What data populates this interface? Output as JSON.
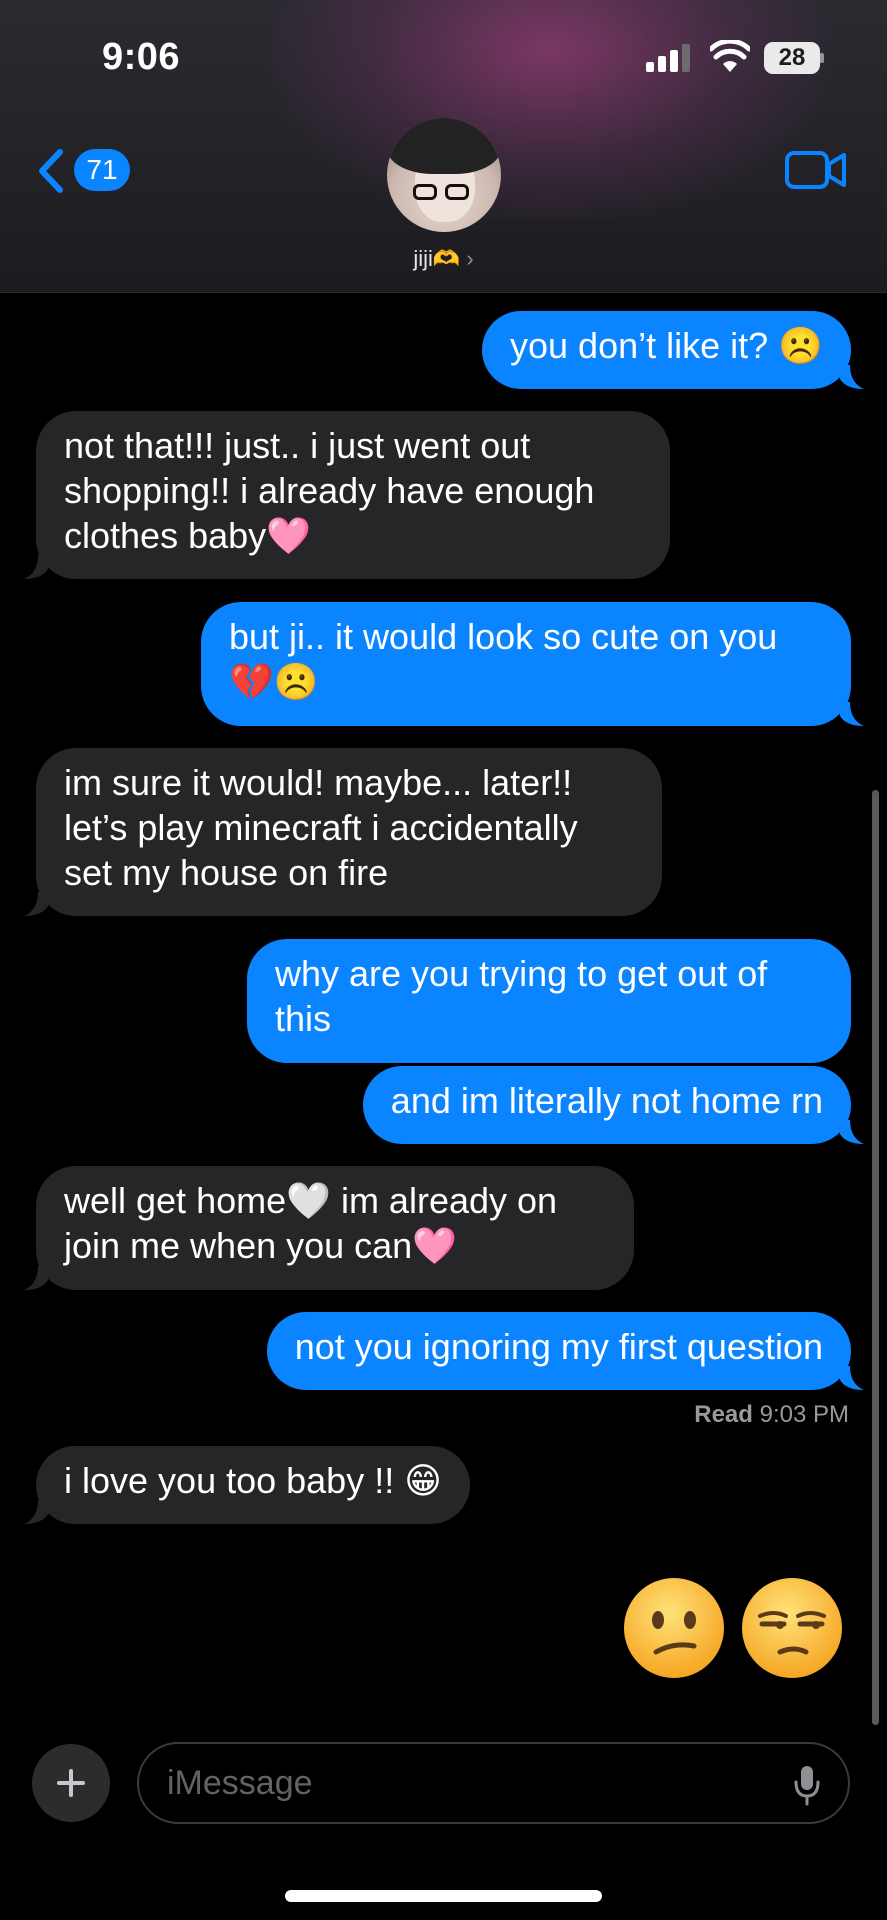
{
  "status_bar": {
    "time": "9:06",
    "battery": "28"
  },
  "nav": {
    "back_badge": "71",
    "contact_name": "jiji🫶",
    "contact_chevron": "›"
  },
  "messages": [
    {
      "from": "me",
      "text": "you don’t like it? ☹️"
    },
    {
      "from": "them",
      "text": "not that!!! just.. i just went out shopping!! i already have enough clothes baby🩷"
    },
    {
      "from": "me",
      "text": "but ji.. it would look so cute on you 💔☹️"
    },
    {
      "from": "them",
      "text": "im sure it would! maybe... later!! let’s play minecraft i accidentally set my house on fire"
    },
    {
      "from": "me",
      "text": "why are you trying to get out of this"
    },
    {
      "from": "me",
      "text": "and im literally not home rn"
    },
    {
      "from": "them",
      "text": "well get home🤍 im already on join me when you can🩷"
    },
    {
      "from": "me",
      "text": "not you ignoring my first question"
    },
    {
      "from": "them",
      "text": "i love you too baby !! 😁"
    }
  ],
  "read_receipt": {
    "label": "Read",
    "time": "9:03 PM"
  },
  "big_emojis": [
    "😕",
    "😒"
  ],
  "input": {
    "placeholder": "iMessage"
  },
  "colors": {
    "sent_bubble": "#0a84ff",
    "received_bubble": "#262628",
    "background": "#000000"
  }
}
